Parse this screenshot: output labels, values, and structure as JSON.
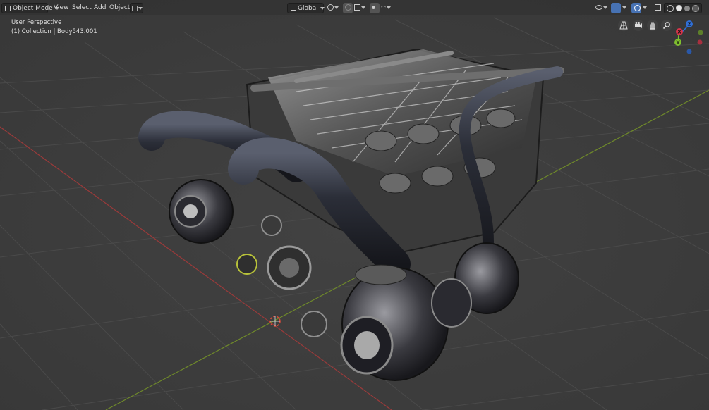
{
  "header": {
    "mode_label": "Object Mode",
    "menu": {
      "view": "View",
      "select": "Select",
      "add": "Add",
      "object": "Object"
    },
    "transform_orientation": "Global"
  },
  "viewport": {
    "perspective_label": "User Perspective",
    "collection_label": "(1) Collection | Body543.001"
  },
  "gizmo": {
    "axes": [
      {
        "label": "Z",
        "color": "#2f6fd8"
      },
      {
        "label": "X",
        "color": "#d8344a"
      },
      {
        "label": "Y",
        "color": "#7fbf2f"
      }
    ]
  },
  "colors": {
    "background": "#3d3d3d",
    "grid_line": "#4a4a4a",
    "x_axis_line": "#9b3a3a",
    "y_axis_line": "#6f8a2a",
    "accent": "#4772b3"
  }
}
